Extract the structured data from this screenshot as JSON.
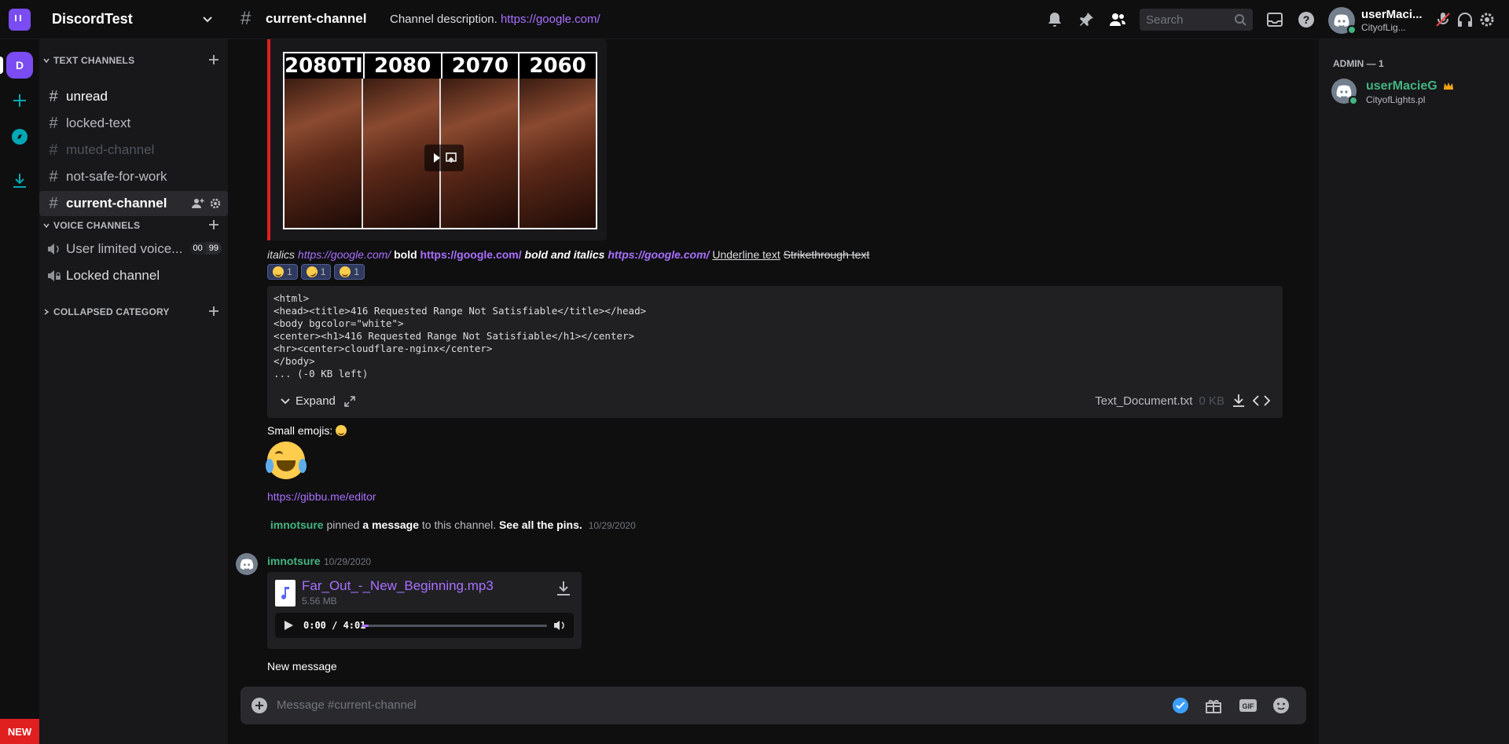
{
  "app": {
    "server_name": "DiscordTest",
    "channel_name": "current-channel",
    "topic_text": "Channel description.",
    "topic_link": "https://google.com/",
    "search_placeholder": "Search",
    "user_name": "userMaci...",
    "user_activity": "CityofLig..."
  },
  "colors": {
    "accent": "#7a4cf2",
    "link": "#a970ff",
    "online": "#43b581",
    "new_badge": "#e01f1f"
  },
  "rail": {
    "guild_initial": "D",
    "new_label": "NEW"
  },
  "sidebar": {
    "text_category": "TEXT CHANNELS",
    "voice_category": "VOICE CHANNELS",
    "collapsed_category": "COLLAPSED CATEGORY",
    "channels": [
      {
        "name": "unread",
        "state": "unread"
      },
      {
        "name": "locked-text",
        "state": "locked"
      },
      {
        "name": "muted-channel",
        "state": "muted"
      },
      {
        "name": "not-safe-for-work",
        "state": "nsfw"
      },
      {
        "name": "current-channel",
        "state": "active"
      }
    ],
    "voice_channels": [
      {
        "name": "User limited voice...",
        "count_current": "00",
        "count_limit": "99"
      },
      {
        "name": "Locked channel"
      }
    ]
  },
  "embed": {
    "video_labels": [
      "2080TI",
      "2080",
      "2070",
      "2060"
    ]
  },
  "formatting": {
    "italics": "italics",
    "link1": "https://google.com/",
    "bold": "bold",
    "link2": "https://google.com/",
    "bold_italics": "bold and italics",
    "link3": "https://google.com/",
    "underline": "Underline text",
    "strike": "Strikethrough text"
  },
  "reactions": [
    {
      "emoji": "grinning",
      "count": "1"
    },
    {
      "emoji": "rofl",
      "count": "1"
    },
    {
      "emoji": "innocent",
      "count": "1"
    }
  ],
  "code_attachment": {
    "content": "<html>\n<head><title>416 Requested Range Not Satisfiable</title></head>\n<body bgcolor=\"white\">\n<center><h1>416 Requested Range Not Satisfiable</h1></center>\n<hr><center>cloudflare-nginx</center>\n</body>\n... (-0 KB left)",
    "expand_label": "Expand",
    "file_name": "Text_Document.txt",
    "file_size": "0 KB"
  },
  "messages": {
    "small_emojis": "Small emojis:",
    "link": "https://gibbu.me/editor",
    "pin_author": "imnotsure",
    "pin_text1": "pinned",
    "pin_bold1": "a message",
    "pin_text2": "to this channel.",
    "pin_bold2": "See all the pins.",
    "pin_time": "10/29/2020",
    "author": "imnotsure",
    "time": "10/29/2020",
    "audio_name": "Far_Out_-_New_Beginning.mp3",
    "audio_size": "5.56 MB",
    "audio_time": "0:00 / 4:01",
    "audio_progress": 0.04,
    "last_message": "New message"
  },
  "composer": {
    "placeholder": "Message #current-channel"
  },
  "members": {
    "role": "ADMIN — 1",
    "list": [
      {
        "name": "userMacieG",
        "activity": "CityofLights.pl"
      }
    ]
  }
}
